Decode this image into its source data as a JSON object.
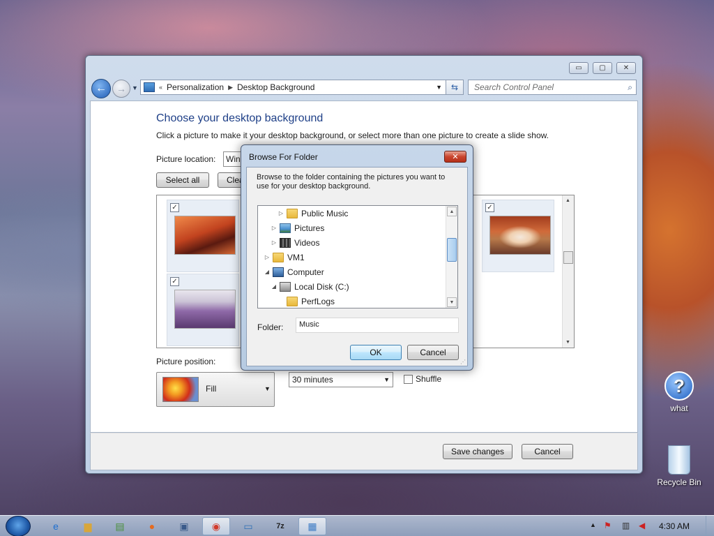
{
  "window": {
    "title_buttons": {
      "minimize": "▭",
      "maximize": "▢",
      "close": "✕"
    },
    "breadcrumb": [
      "Personalization",
      "Desktop Background"
    ],
    "breadcrumb_prefix": "«",
    "search_placeholder": "Search Control Panel"
  },
  "page": {
    "heading": "Choose your desktop background",
    "subtext": "Click a picture to make it your desktop background, or select more than one picture to create a slide show.",
    "picture_location_label": "Picture location:",
    "picture_location_value": "Windows Desktop Backgrounds",
    "select_all": "Select all",
    "clear_all": "Clear all",
    "picture_position_label": "Picture position:",
    "picture_position_value": "Fill",
    "interval_value": "30 minutes",
    "shuffle_label": "Shuffle"
  },
  "footer": {
    "save": "Save changes",
    "cancel": "Cancel"
  },
  "dialog": {
    "title": "Browse For Folder",
    "close": "✕",
    "description": "Browse to the folder containing the pictures you want to use for your desktop background.",
    "tree": [
      {
        "label": "Public Music",
        "arrow": "▷",
        "icon": "folder"
      },
      {
        "label": "Pictures",
        "arrow": "▷",
        "icon": "pictures"
      },
      {
        "label": "Videos",
        "arrow": "▷",
        "icon": "videos"
      },
      {
        "label": "VM1",
        "arrow": "▷",
        "icon": "user"
      },
      {
        "label": "Computer",
        "arrow": "◢",
        "icon": "computer"
      },
      {
        "label": "Local Disk (C:)",
        "arrow": "◢",
        "icon": "drive"
      },
      {
        "label": "PerfLogs",
        "arrow": "",
        "icon": "folder"
      }
    ],
    "folder_label": "Folder:",
    "folder_value": "Music",
    "ok": "OK",
    "cancel": "Cancel"
  },
  "desktop": {
    "icons": [
      "what",
      "Recycle Bin"
    ]
  },
  "taskbar": {
    "clock": "4:30 AM"
  }
}
